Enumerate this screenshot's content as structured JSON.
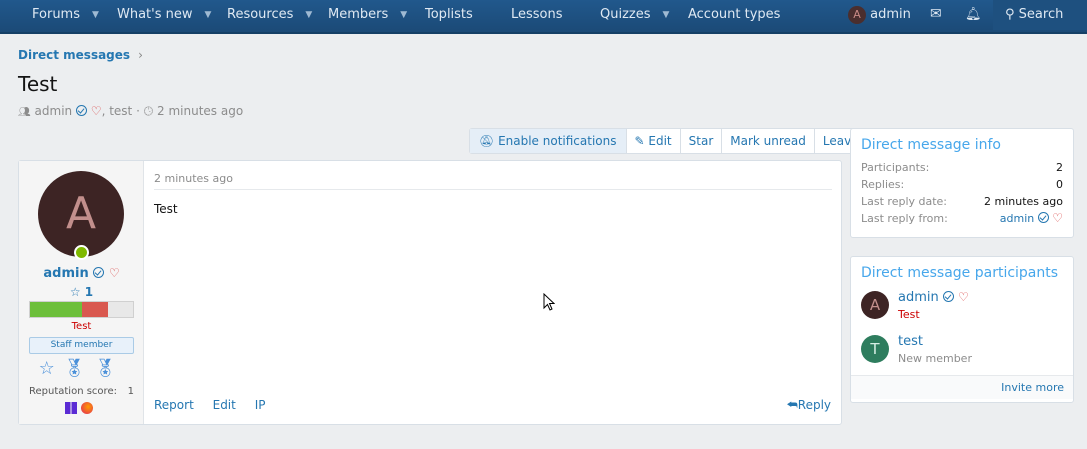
{
  "nav": {
    "items": [
      {
        "label": "Forums"
      },
      {
        "label": "What's new"
      },
      {
        "label": "Resources"
      },
      {
        "label": "Members"
      },
      {
        "label": "Toplists"
      },
      {
        "label": "Lessons"
      },
      {
        "label": "Quizzes"
      },
      {
        "label": "Account types"
      }
    ],
    "user_label": "admin",
    "avatar_letter": "A",
    "search_label": "Search"
  },
  "breadcrumb": {
    "label": "Direct messages"
  },
  "page": {
    "title": "Test",
    "meta_starter": "admin",
    "meta_other": "test",
    "meta_time": "2 minutes ago"
  },
  "toolbar": {
    "enable_notifications": "Enable notifications",
    "edit": "Edit",
    "star": "Star",
    "mark_unread": "Mark unread",
    "leave": "Leave"
  },
  "message": {
    "avatar_letter": "A",
    "username": "admin",
    "star_count": "1",
    "user_title": "Test",
    "staff_banner": "Staff member",
    "rep_label": "Reputation score:",
    "rep_value": "1",
    "time": "2 minutes ago",
    "body": "Test",
    "actions": {
      "report": "Report",
      "edit": "Edit",
      "ip": "IP",
      "reply": "Reply"
    }
  },
  "info": {
    "title": "Direct message info",
    "rows": [
      {
        "k": "Participants:",
        "v": "2"
      },
      {
        "k": "Replies:",
        "v": "0"
      },
      {
        "k": "Last reply date:",
        "v": "2 minutes ago"
      },
      {
        "k": "Last reply from:",
        "v": "admin"
      }
    ]
  },
  "participants": {
    "title": "Direct message participants",
    "list": [
      {
        "letter": "A",
        "name": "admin",
        "sub": "Test"
      },
      {
        "letter": "T",
        "name": "test",
        "sub": "New member"
      }
    ],
    "invite": "Invite more"
  },
  "colors": {
    "nav_bg": "#1b4a77",
    "link": "#2577b1",
    "accent": "#47a7eb",
    "red_title": "#cc0000"
  }
}
